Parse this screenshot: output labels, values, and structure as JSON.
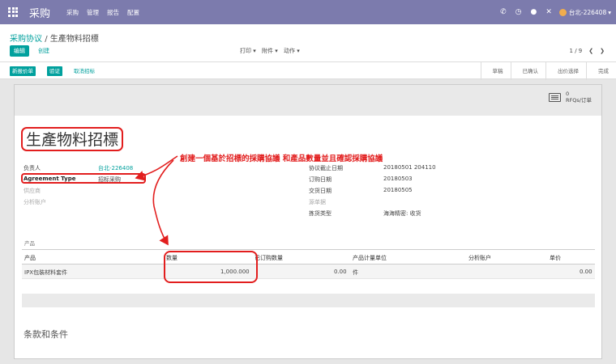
{
  "topbar": {
    "app_title": "采购",
    "menu": [
      "采购",
      "管理",
      "报告",
      "配置"
    ],
    "user": "台北-226408"
  },
  "breadcrumb": {
    "parent": "采购协议",
    "separator": "/",
    "current": "生產物料招標"
  },
  "control": {
    "edit_label": "编辑",
    "create_label": "创建",
    "print_label": "打印 ▾",
    "attachment_label": "附件 ▾",
    "action_label": "动作 ▾",
    "pager": "1 / 9"
  },
  "header": {
    "new_quote_label": "新报价单",
    "validate_label": "验证",
    "cancel_label": "取消招标",
    "stages": [
      "草稿",
      "已确认",
      "出价选择",
      "完成"
    ]
  },
  "stat": {
    "count": "0",
    "label": "RFQs/订单"
  },
  "title": "生產物料招標",
  "annotation": "創建一個基於招標的採購協議 和產品數量並且確認採購協議",
  "fields_left": {
    "owner_label": "负责人",
    "owner_value": "台北-226408",
    "agreement_type_label": "Agreement Type",
    "agreement_type_value": "招标采购",
    "vendor_label": "供应商",
    "analytic_label": "分析账户"
  },
  "fields_right": {
    "deadline_label": "协议截止日期",
    "deadline_value": "20180501 204110",
    "order_date_label": "订购日期",
    "order_date_value": "20180503",
    "delivery_label": "交货日期",
    "delivery_value": "20180505",
    "source_label": "源单据",
    "picking_label": "拣货类型",
    "picking_value": "海海精密: 收货"
  },
  "products": {
    "section_label": "产品",
    "headers": [
      "产品",
      "数量",
      "已订购数量",
      "产品计量单位",
      "分析账户",
      "单价"
    ],
    "row": {
      "product": "IPX包裝材料套件",
      "qty": "1,000.000",
      "ordered": "0.00",
      "uom": "件",
      "price": "0.00"
    }
  },
  "terms_label": "条款和条件",
  "colors": {
    "brand": "#7c7bad",
    "accent": "#00a09d",
    "annotation": "#e21e1e"
  }
}
